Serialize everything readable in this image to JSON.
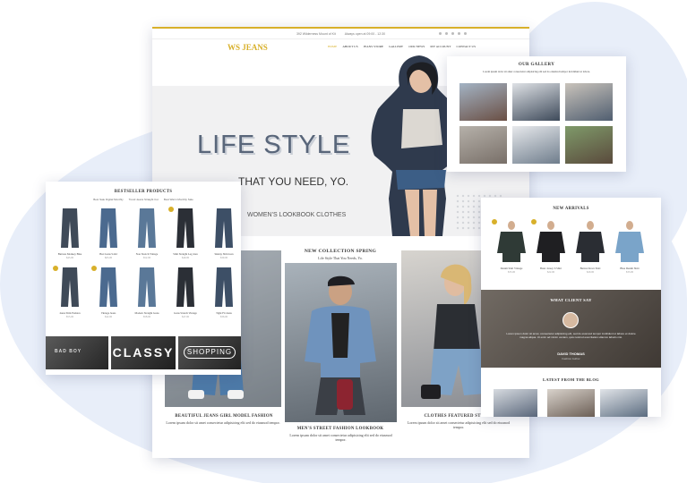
{
  "topbar": {
    "address": "392 Wilderness Mount of Kit",
    "hours": "Always open at 09:00 - 12:30"
  },
  "header": {
    "logo_mark": "WS",
    "logo_text": "JEANS",
    "nav": [
      "HOME",
      "ABOUT US",
      "JEANS STORE",
      "GALLERY",
      "OUR NEWS",
      "MY ACCOUNT",
      "CONTACT US"
    ]
  },
  "hero": {
    "title": "LIFE STYLE",
    "subtitle": "THAT YOU NEED, YO.",
    "tagline": "WOMEN'S LOOKBOOK CLOTHES"
  },
  "collection": {
    "heading": "NEW COLLECTION SPRING",
    "subheading": "Life Style That You Needs, Yo.",
    "left_caption": "BEAUTIFUL JEANS GIRL MODEL FASHION",
    "center_caption": "MEN'S STREET FASHION LOOKBOOK",
    "right_caption": "CLOTHES FEATURED STYLES",
    "caption_desc": "Lorem ipsum dolor sit amet consectetur adipisicing elit sed do eiusmod tempor."
  },
  "gallery": {
    "title": "OUR GALLERY",
    "desc": "Lorem ipsum dolor sit amet consectetur adipisicing elit sed do eiusmod tempor incididunt ut labore."
  },
  "bestseller": {
    "title": "BESTSELLER PRODUCTS",
    "tabs": [
      "Best Sale Digital Monthly",
      "Trend Jeans Straight Cut",
      "Best Warm Monthly Sale"
    ],
    "products": [
      {
        "name": "Buttons Monkey Blue",
        "price": "$45.00"
      },
      {
        "name": "Bret Jeans Solid",
        "price": "$65.00"
      },
      {
        "name": "Non Stretch Vintage",
        "price": "$52.00"
      },
      {
        "name": "Slim Straight Leg Jean",
        "price": "$49.00"
      },
      {
        "name": "Skinny Slim Jean",
        "price": "$39.00"
      },
      {
        "name": "Jeans Slim Fashion",
        "price": "$55.00"
      },
      {
        "name": "Vintage Jeans",
        "price": "$42.00"
      },
      {
        "name": "Modern Straight Jeans",
        "price": "$58.00"
      },
      {
        "name": "Jeans Stretch Vintage",
        "price": "$47.00"
      },
      {
        "name": "Tight Fit Jeans",
        "price": "$36.00"
      }
    ],
    "banner_left": "BAD BOY",
    "banner_center": "CLASSY",
    "banner_right": "SHOPPING"
  },
  "arrivals": {
    "title": "NEW ARRIVALS",
    "products": [
      {
        "name": "Denim Shirt Vintage",
        "price": "$35.00"
      },
      {
        "name": "Basic Jersey T-Shirt",
        "price": "$22.00"
      },
      {
        "name": "Button Down Shirt",
        "price": "$29.00"
      },
      {
        "name": "Blue Denim Shirt",
        "price": "$33.00"
      }
    ]
  },
  "testimonial": {
    "title": "WHAT CLIENT SAY",
    "quote": "Lorem ipsum dolor sit amet, consectetur adipisicing elit, sed do eiusmod tempor incididunt ut labore et dolore magna aliqua. Ut enim ad minim veniam, quis nostrud exercitation ullamco laboris nisi.",
    "name": "DAVID THOMAS",
    "role": "Fashion Author"
  },
  "blog": {
    "title": "LATEST FROM THE BLOG"
  },
  "colors": {
    "accent": "#d8b02a",
    "hero_title": "#59667a",
    "background_blob": "#e8eef9"
  }
}
